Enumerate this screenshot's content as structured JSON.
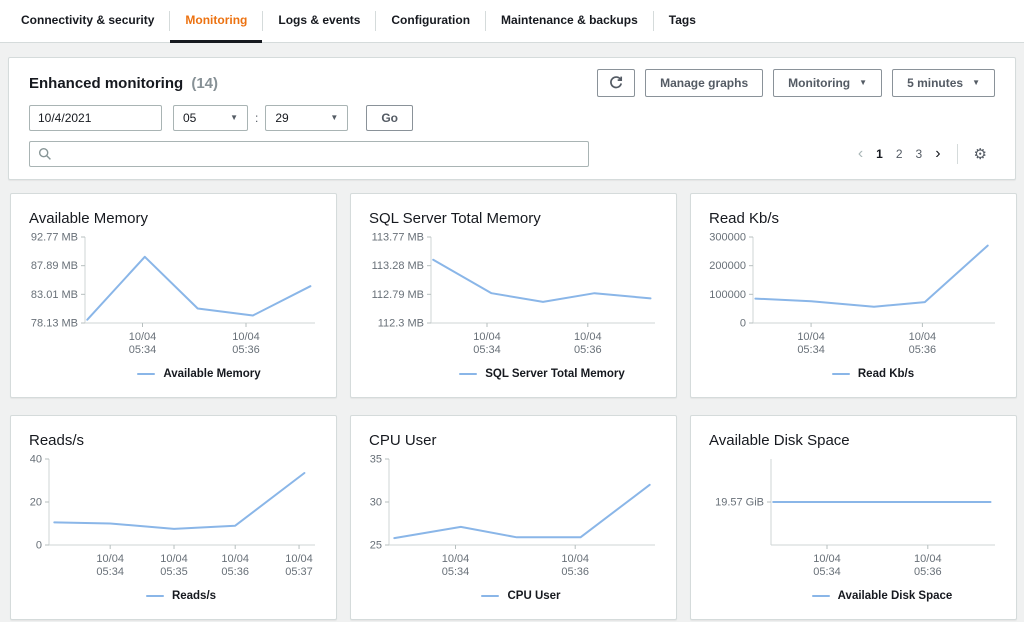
{
  "tabs": {
    "items": [
      {
        "label": "Connectivity & security",
        "active": false
      },
      {
        "label": "Monitoring",
        "active": true
      },
      {
        "label": "Logs & events",
        "active": false
      },
      {
        "label": "Configuration",
        "active": false
      },
      {
        "label": "Maintenance & backups",
        "active": false
      },
      {
        "label": "Tags",
        "active": false
      }
    ]
  },
  "panel": {
    "title": "Enhanced monitoring",
    "count": "(14)",
    "manage_graphs_label": "Manage graphs",
    "monitoring_dropdown_label": "Monitoring",
    "interval_dropdown_label": "5 minutes",
    "date_value": "10/4/2021",
    "hour_value": "05",
    "time_separator": ":",
    "minute_value": "29",
    "go_label": "Go",
    "search_placeholder": "",
    "pagination": {
      "prev": "‹",
      "pages": [
        "1",
        "2",
        "3"
      ],
      "current": "1",
      "next": "›"
    }
  },
  "icons": {
    "caret_down": "▼",
    "gear": "⚙"
  },
  "colors": {
    "tab_accent": "#ec7211",
    "active_underline": "#16191f",
    "line": "#8ab6e8",
    "panel_border": "#d5dbdb",
    "axis": "#cfd5d5",
    "tick": "#b7bfbf",
    "tick_text": "#687078",
    "button_text": "#545b64"
  },
  "chart_data": [
    {
      "type": "line",
      "title": "Available Memory",
      "legend": "Available Memory",
      "grid": false,
      "legend_position": "bottom",
      "ylim": [
        78.13,
        92.77
      ],
      "yticks": [
        {
          "v": 92.77,
          "label": "92.77 MB"
        },
        {
          "v": 87.89,
          "label": "87.89 MB"
        },
        {
          "v": 83.01,
          "label": "83.01 MB"
        },
        {
          "v": 78.13,
          "label": "78.13 MB"
        }
      ],
      "xticks": [
        {
          "pos": 0.25,
          "label": [
            "10/04",
            "05:34"
          ]
        },
        {
          "pos": 0.7,
          "label": [
            "10/04",
            "05:36"
          ]
        }
      ],
      "points": [
        {
          "pos": 0.01,
          "v": 78.7
        },
        {
          "pos": 0.26,
          "v": 89.4
        },
        {
          "pos": 0.49,
          "v": 80.6
        },
        {
          "pos": 0.73,
          "v": 79.4
        },
        {
          "pos": 0.98,
          "v": 84.4
        }
      ]
    },
    {
      "type": "line",
      "title": "SQL Server Total Memory",
      "legend": "SQL Server Total Memory",
      "grid": false,
      "legend_position": "bottom",
      "ylim": [
        112.3,
        113.77
      ],
      "yticks": [
        {
          "v": 113.77,
          "label": "113.77 MB"
        },
        {
          "v": 113.28,
          "label": "113.28 MB"
        },
        {
          "v": 112.79,
          "label": "112.79 MB"
        },
        {
          "v": 112.3,
          "label": "112.3 MB"
        }
      ],
      "xticks": [
        {
          "pos": 0.25,
          "label": [
            "10/04",
            "05:34"
          ]
        },
        {
          "pos": 0.7,
          "label": [
            "10/04",
            "05:36"
          ]
        }
      ],
      "points": [
        {
          "pos": 0.01,
          "v": 113.38
        },
        {
          "pos": 0.27,
          "v": 112.81
        },
        {
          "pos": 0.5,
          "v": 112.66
        },
        {
          "pos": 0.73,
          "v": 112.81
        },
        {
          "pos": 0.98,
          "v": 112.72
        }
      ]
    },
    {
      "type": "line",
      "title": "Read Kb/s",
      "legend": "Read Kb/s",
      "grid": false,
      "legend_position": "bottom",
      "ylim": [
        0,
        300000
      ],
      "yticks": [
        {
          "v": 300000,
          "label": "300000"
        },
        {
          "v": 200000,
          "label": "200000"
        },
        {
          "v": 100000,
          "label": "100000"
        },
        {
          "v": 0,
          "label": "0"
        }
      ],
      "xticks": [
        {
          "pos": 0.24,
          "label": [
            "10/04",
            "05:34"
          ]
        },
        {
          "pos": 0.7,
          "label": [
            "10/04",
            "05:36"
          ]
        }
      ],
      "points": [
        {
          "pos": 0.01,
          "v": 85000
        },
        {
          "pos": 0.24,
          "v": 76000
        },
        {
          "pos": 0.5,
          "v": 57000
        },
        {
          "pos": 0.71,
          "v": 73000
        },
        {
          "pos": 0.97,
          "v": 270000
        }
      ]
    },
    {
      "type": "line",
      "title": "Reads/s",
      "legend": "Reads/s",
      "grid": false,
      "legend_position": "bottom",
      "ylim": [
        0,
        40
      ],
      "yticks": [
        {
          "v": 40,
          "label": "40"
        },
        {
          "v": 20,
          "label": "20"
        },
        {
          "v": 0,
          "label": "0"
        }
      ],
      "xticks": [
        {
          "pos": 0.23,
          "label": [
            "10/04",
            "05:34"
          ]
        },
        {
          "pos": 0.47,
          "label": [
            "10/04",
            "05:35"
          ]
        },
        {
          "pos": 0.7,
          "label": [
            "10/04",
            "05:36"
          ]
        },
        {
          "pos": 0.94,
          "label": [
            "10/04",
            "05:37"
          ]
        }
      ],
      "points": [
        {
          "pos": 0.02,
          "v": 10.5
        },
        {
          "pos": 0.23,
          "v": 10
        },
        {
          "pos": 0.47,
          "v": 7.5
        },
        {
          "pos": 0.7,
          "v": 9
        },
        {
          "pos": 0.96,
          "v": 33.5
        }
      ]
    },
    {
      "type": "line",
      "title": "CPU User",
      "legend": "CPU User",
      "grid": false,
      "legend_position": "bottom",
      "ylim": [
        25,
        35
      ],
      "yticks": [
        {
          "v": 35,
          "label": "35"
        },
        {
          "v": 30,
          "label": "30"
        },
        {
          "v": 25,
          "label": "25"
        }
      ],
      "xticks": [
        {
          "pos": 0.25,
          "label": [
            "10/04",
            "05:34"
          ]
        },
        {
          "pos": 0.7,
          "label": [
            "10/04",
            "05:36"
          ]
        }
      ],
      "points": [
        {
          "pos": 0.02,
          "v": 25.8
        },
        {
          "pos": 0.27,
          "v": 27.1
        },
        {
          "pos": 0.48,
          "v": 25.9
        },
        {
          "pos": 0.72,
          "v": 25.9
        },
        {
          "pos": 0.98,
          "v": 32
        }
      ]
    },
    {
      "type": "line",
      "title": "Available Disk Space",
      "legend": "Available Disk Space",
      "grid": false,
      "legend_position": "bottom",
      "ylim": [
        19.07,
        20.07
      ],
      "yticks": [
        {
          "v": 19.57,
          "label": "19.57 GiB"
        }
      ],
      "xticks": [
        {
          "pos": 0.25,
          "label": [
            "10/04",
            "05:34"
          ]
        },
        {
          "pos": 0.7,
          "label": [
            "10/04",
            "05:36"
          ]
        }
      ],
      "points": [
        {
          "pos": 0.01,
          "v": 19.57
        },
        {
          "pos": 0.98,
          "v": 19.57
        }
      ]
    }
  ]
}
